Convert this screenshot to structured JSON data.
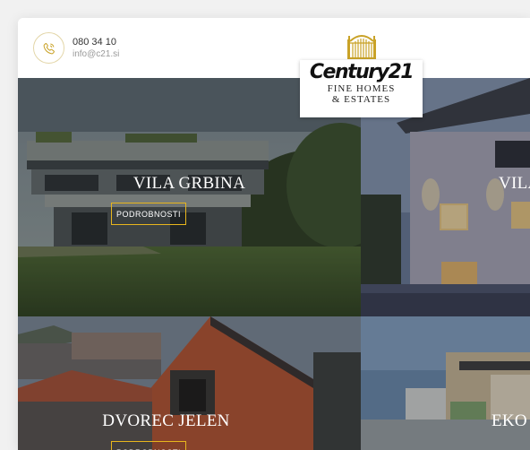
{
  "header": {
    "phone": "080 34 10",
    "email": "info@c21.si",
    "logo_brand": "Century21",
    "logo_line1": "FINE HOMES",
    "logo_line2": "& ESTATES"
  },
  "properties": [
    {
      "title": "VILA GRBINA",
      "button": "PODROBNOSTI"
    },
    {
      "title": "VILA"
    },
    {
      "title": "DVOREC JELEN",
      "button": "PODROBNOSTI"
    },
    {
      "title": "EKO"
    }
  ],
  "colors": {
    "accent": "#e8b61d",
    "gold": "#c9a227"
  },
  "icons": {
    "phone": "phone-icon",
    "gate": "gate-logo-icon"
  }
}
